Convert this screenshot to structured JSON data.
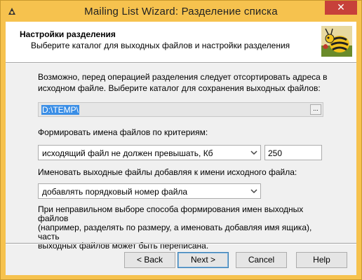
{
  "window": {
    "title": "Mailing List Wizard: Разделение списка",
    "close_label": "✕"
  },
  "header": {
    "title": "Настройки разделения",
    "subtitle": "Выберите каталог для выходных файлов и настройки разделения"
  },
  "body": {
    "intro_line1": "Возможно, перед операцией разделения следует отсортировать адреса в",
    "intro_line2": "исходном файле. Выберите каталог для сохранения выходных файлов:",
    "output_dir": "D:\\TEMP\\",
    "browse_label": "...",
    "criteria_label": "Формировать имена файлов по критериям:",
    "criteria_value": "исходящий файл не должен превышать, Кб",
    "size_value": "250",
    "naming_label": "Именовать выходные файлы добавляя к имени исходного файла:",
    "naming_value": "добавлять порядковый номер файла",
    "note_line1": "При неправильном выборе способа формирования имен выходных файлов",
    "note_line2": "(например, разделять по размеру, а именовать добавляя имя ящика), часть",
    "note_line3": "выходных файлов может быть переписана."
  },
  "buttons": {
    "back": "< Back",
    "next": "Next >",
    "cancel": "Cancel",
    "help": "Help"
  },
  "colors": {
    "titlebar": "#f6c24e",
    "close": "#c7403a",
    "selection": "#3a8ee6"
  },
  "icons": {
    "app": "app-icon",
    "mascot": "bee-mascot-icon"
  }
}
